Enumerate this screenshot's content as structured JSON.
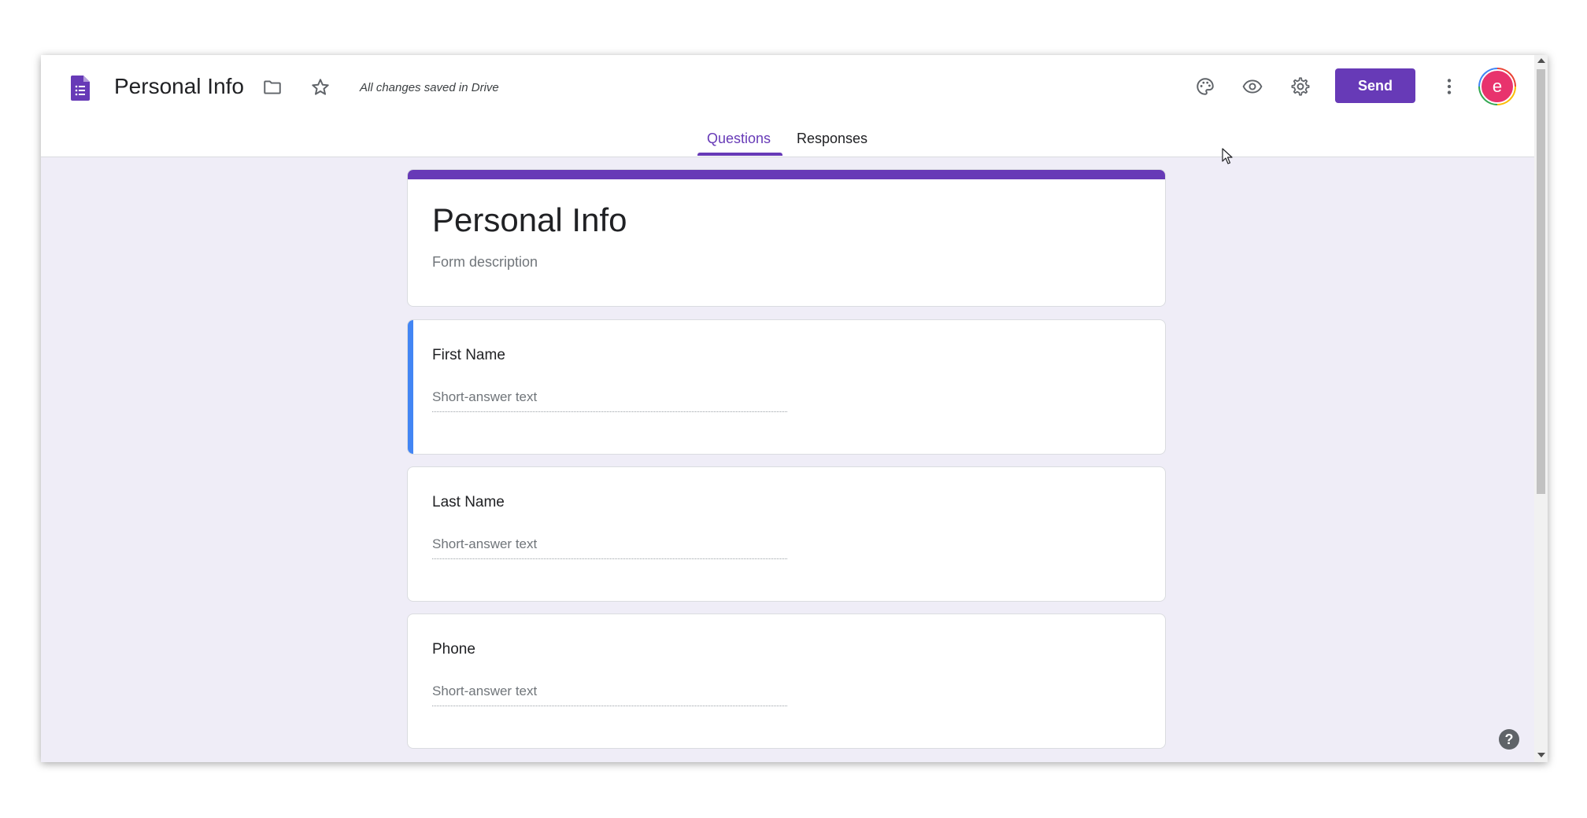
{
  "header": {
    "doc_title": "Personal Info",
    "save_status": "All changes saved in Drive",
    "send_label": "Send",
    "avatar_letter": "e",
    "icons": [
      "forms-logo-icon",
      "folder-icon",
      "star-icon",
      "palette-icon",
      "eye-icon",
      "gear-icon",
      "more-vert-icon"
    ]
  },
  "tabs": [
    {
      "label": "Questions",
      "active": true
    },
    {
      "label": "Responses",
      "active": false
    }
  ],
  "form": {
    "title": "Personal Info",
    "description_placeholder": "Form description"
  },
  "questions": [
    {
      "label": "First Name",
      "answer_placeholder": "Short-answer text",
      "selected": true
    },
    {
      "label": "Last Name",
      "answer_placeholder": "Short-answer text",
      "selected": false
    },
    {
      "label": "Phone",
      "answer_placeholder": "Short-answer text",
      "selected": false
    }
  ],
  "help": {
    "label": "?"
  },
  "colors": {
    "accent": "#673ab7",
    "selected_question": "#4285f4",
    "background": "#efedf7",
    "avatar": "#e8336d"
  }
}
